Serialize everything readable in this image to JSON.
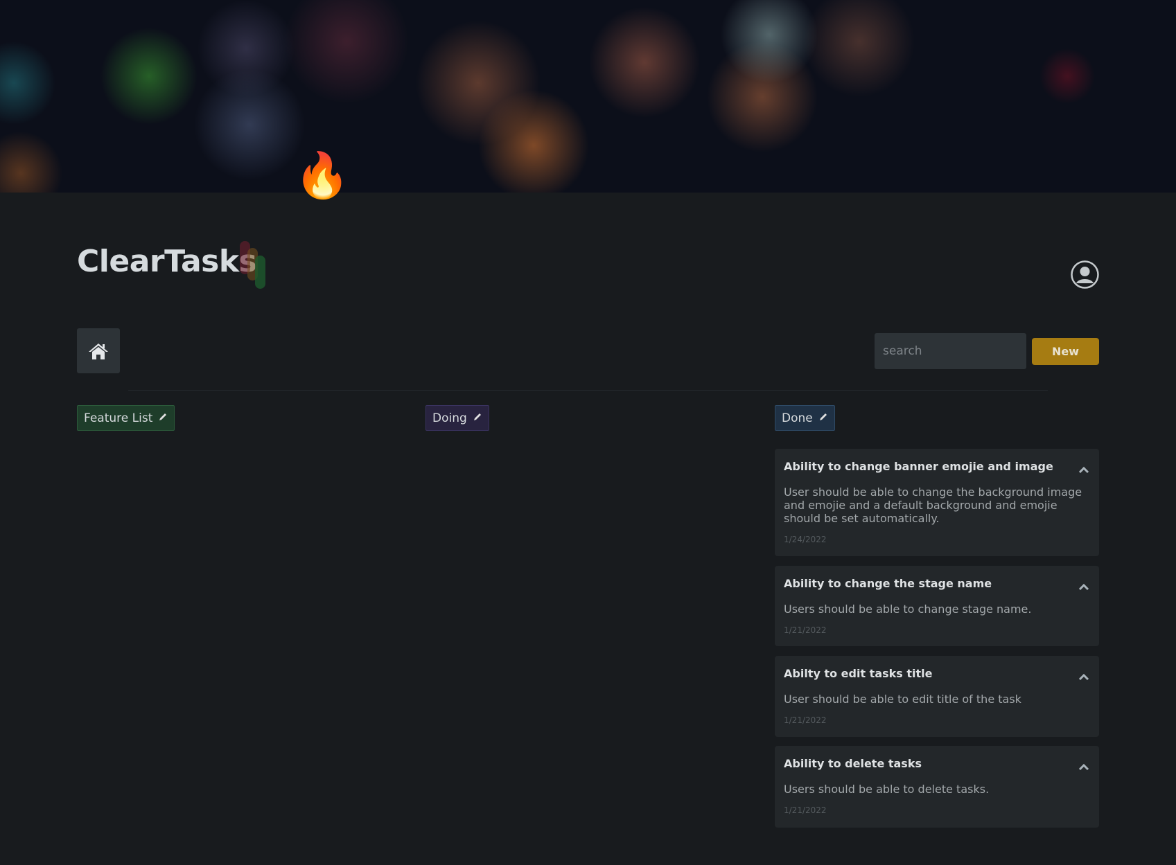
{
  "banner": {
    "emoji": "🔥"
  },
  "app": {
    "title": "ClearTasks"
  },
  "toolbar": {
    "search_placeholder": "search",
    "new_label": "New"
  },
  "stages": [
    {
      "label": "Feature List",
      "color": "#1e3d2a"
    },
    {
      "label": "Doing",
      "color": "#28233f"
    },
    {
      "label": "Done",
      "color": "#1f3145"
    }
  ],
  "tasks": [
    {
      "title": "Ability to change banner emojie and image",
      "description": "User should be able to change the background image and emojie and a default background and emojie should be set automatically.",
      "date": "1/24/2022"
    },
    {
      "title": "Ability to change the stage name",
      "description": "Users should be able to change stage name.",
      "date": "1/21/2022"
    },
    {
      "title": "Abilty to edit tasks title",
      "description": "User should be able to edit title of the task",
      "date": "1/21/2022"
    },
    {
      "title": "Ability to delete tasks",
      "description": "Users should be able to delete tasks.",
      "date": "1/21/2022"
    }
  ]
}
